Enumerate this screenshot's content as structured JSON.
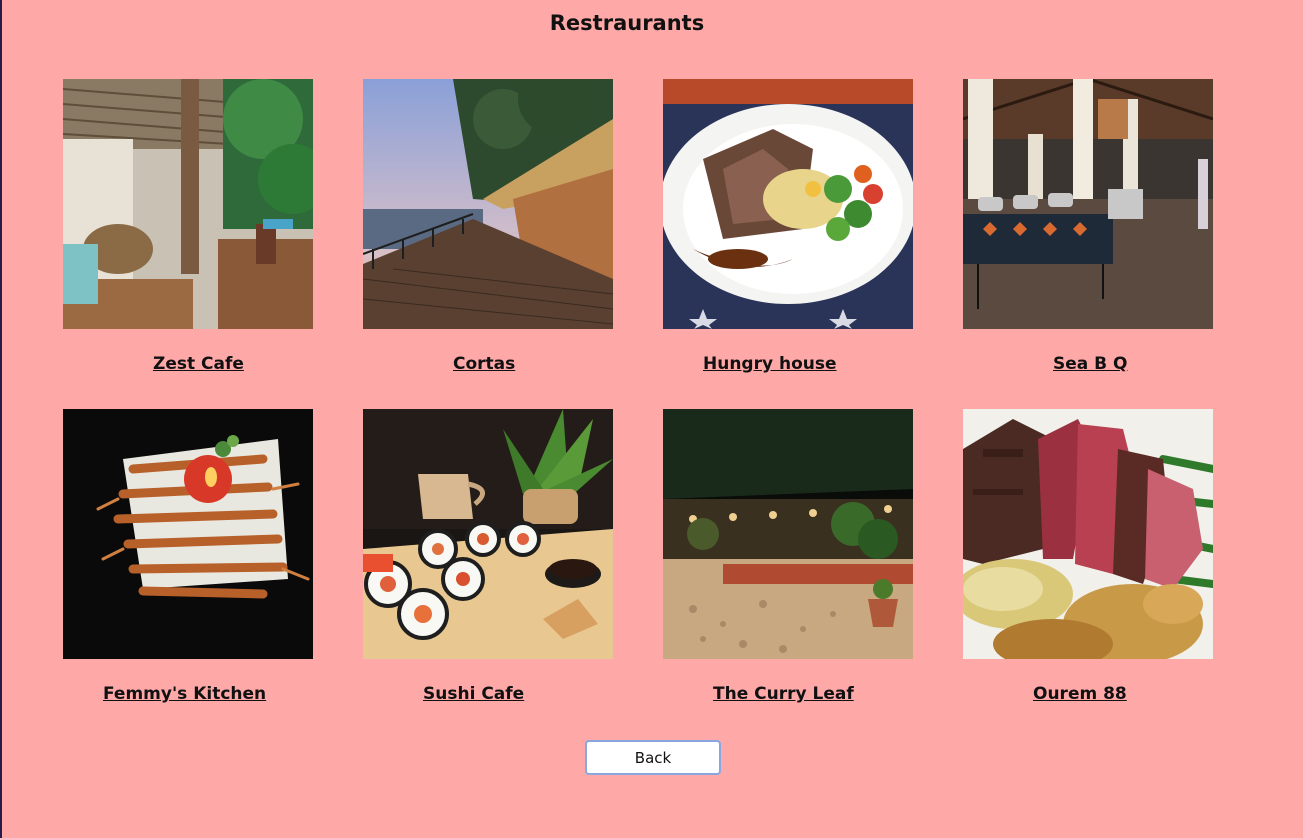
{
  "page": {
    "title": "Restraurants"
  },
  "restaurants": [
    {
      "name": "Zest Cafe",
      "image": "open-air cafe with bamboo roof and wooden tables"
    },
    {
      "name": "Cortas",
      "image": "beachside deck restaurant with thatched roof at sunset"
    },
    {
      "name": "Hungry house",
      "image": "plate of grilled meat with vegetables"
    },
    {
      "name": "Sea B Q",
      "image": "buffet hall with serving counters"
    },
    {
      "name": "Femmy's Kitchen",
      "image": "platter of grilled prawns with candle"
    },
    {
      "name": "Sushi Cafe",
      "image": "sushi rolls on wooden board with plant"
    },
    {
      "name": "The Curry Leaf",
      "image": "restaurant garden at night with lights"
    },
    {
      "name": "Ourem 88",
      "image": "sliced steak with potatoes and green beans"
    }
  ],
  "actions": {
    "back_label": "Back"
  },
  "colors": {
    "background": "#ffa8a8",
    "button_border": "#8aa6e0"
  }
}
